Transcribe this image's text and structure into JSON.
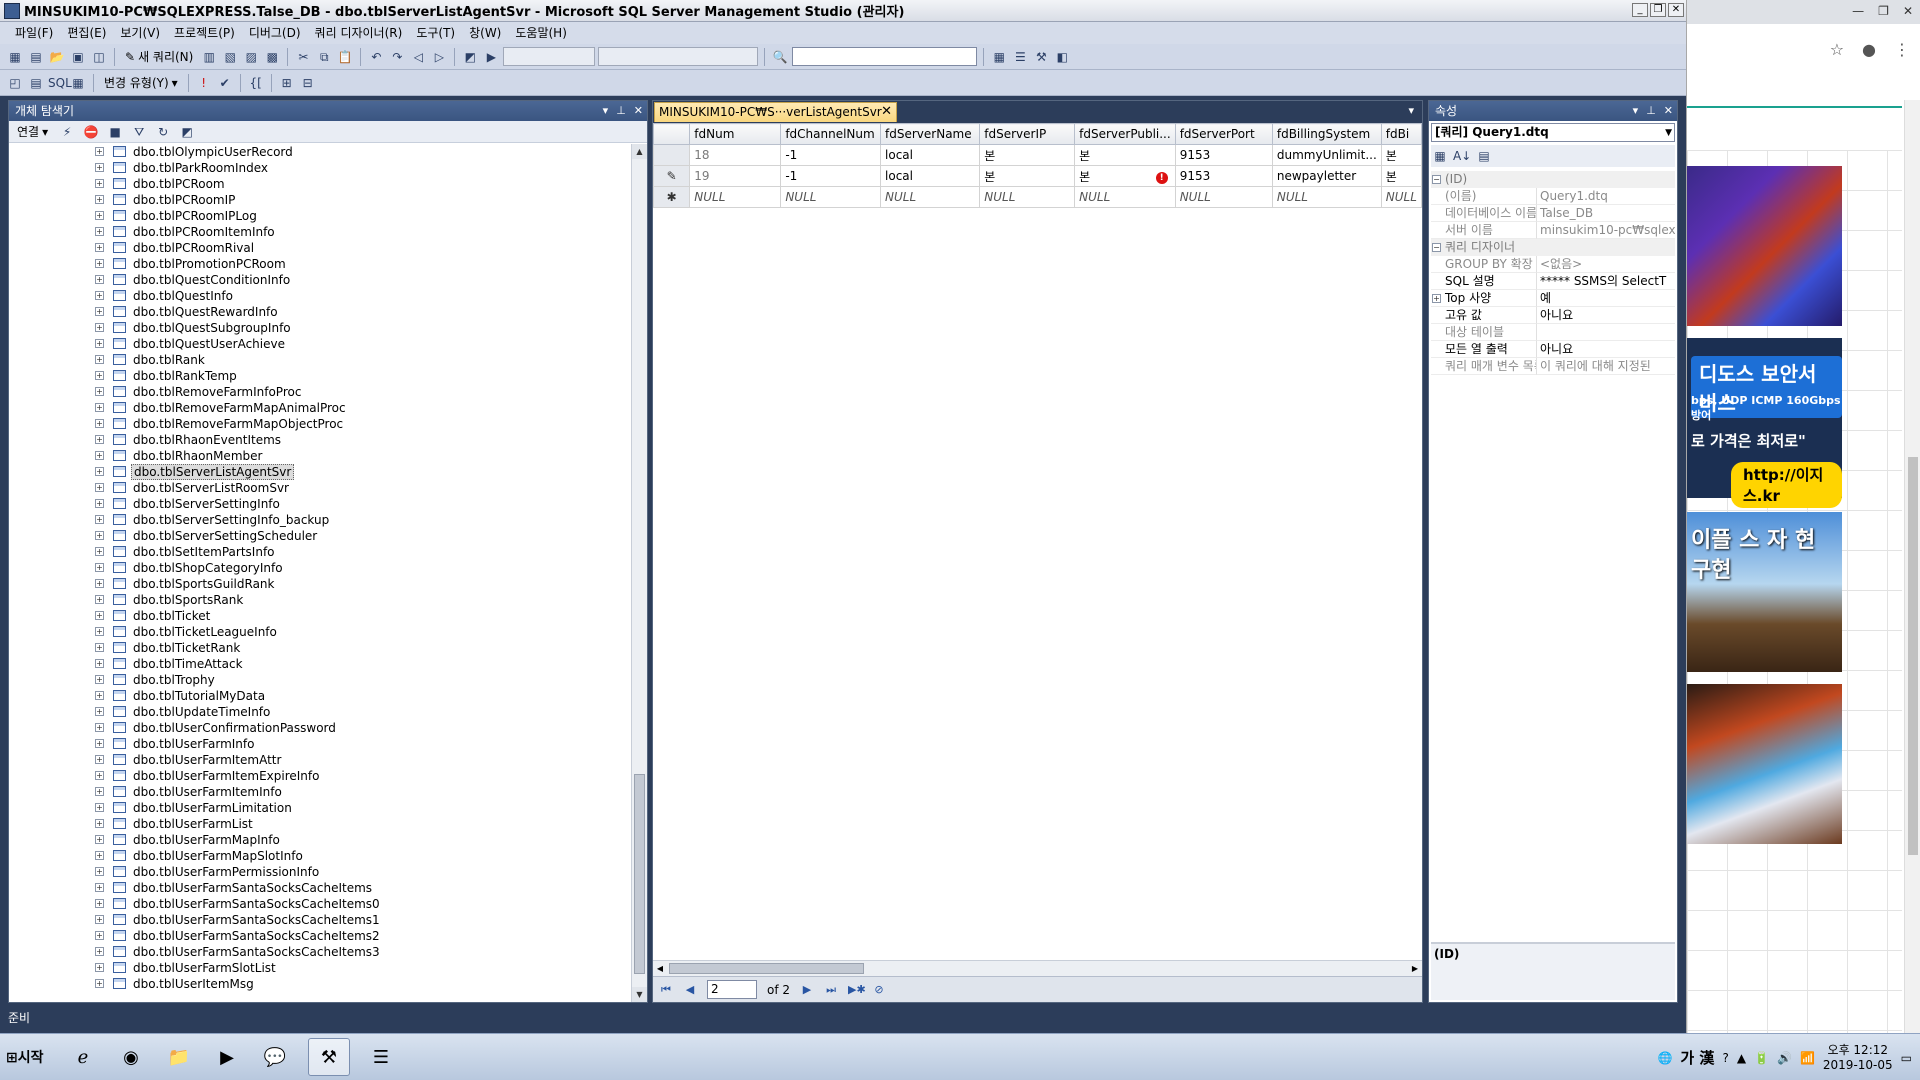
{
  "window": {
    "title": "MINSUKIM10-PC₩SQLEXPRESS.Talse_DB - dbo.tblServerListAgentSvr - Microsoft SQL Server Management Studio (관리자)"
  },
  "menu": [
    "파일(F)",
    "편집(E)",
    "보기(V)",
    "프로젝트(P)",
    "디버그(D)",
    "쿼리 디자이너(R)",
    "도구(T)",
    "창(W)",
    "도움말(H)"
  ],
  "toolbar": {
    "new_query": "새 쿼리(N)",
    "change_type": "변경 유형(Y)"
  },
  "object_explorer": {
    "title": "개체 탐색기",
    "connect": "연결",
    "items": [
      "dbo.tblOlympicUserRecord",
      "dbo.tblParkRoomIndex",
      "dbo.tblPCRoom",
      "dbo.tblPCRoomIP",
      "dbo.tblPCRoomIPLog",
      "dbo.tblPCRoomItemInfo",
      "dbo.tblPCRoomRival",
      "dbo.tblPromotionPCRoom",
      "dbo.tblQuestConditionInfo",
      "dbo.tblQuestInfo",
      "dbo.tblQuestRewardInfo",
      "dbo.tblQuestSubgroupInfo",
      "dbo.tblQuestUserAchieve",
      "dbo.tblRank",
      "dbo.tblRankTemp",
      "dbo.tblRemoveFarmInfoProc",
      "dbo.tblRemoveFarmMapAnimalProc",
      "dbo.tblRemoveFarmMapObjectProc",
      "dbo.tblRhaonEventItems",
      "dbo.tblRhaonMember",
      "dbo.tblServerListAgentSvr",
      "dbo.tblServerListRoomSvr",
      "dbo.tblServerSettingInfo",
      "dbo.tblServerSettingInfo_backup",
      "dbo.tblServerSettingScheduler",
      "dbo.tblSetItemPartsInfo",
      "dbo.tblShopCategoryInfo",
      "dbo.tblSportsGuildRank",
      "dbo.tblSportsRank",
      "dbo.tblTicket",
      "dbo.tblTicketLeagueInfo",
      "dbo.tblTicketRank",
      "dbo.tblTimeAttack",
      "dbo.tblTrophy",
      "dbo.tblTutorialMyData",
      "dbo.tblUpdateTimeInfo",
      "dbo.tblUserConfirmationPassword",
      "dbo.tblUserFarmInfo",
      "dbo.tblUserFarmItemAttr",
      "dbo.tblUserFarmItemExpireInfo",
      "dbo.tblUserFarmItemInfo",
      "dbo.tblUserFarmLimitation",
      "dbo.tblUserFarmList",
      "dbo.tblUserFarmMapInfo",
      "dbo.tblUserFarmMapSlotInfo",
      "dbo.tblUserFarmPermissionInfo",
      "dbo.tblUserFarmSantaSocksCacheItems",
      "dbo.tblUserFarmSantaSocksCacheItems0",
      "dbo.tblUserFarmSantaSocksCacheItems1",
      "dbo.tblUserFarmSantaSocksCacheItems2",
      "dbo.tblUserFarmSantaSocksCacheItems3",
      "dbo.tblUserFarmSlotList",
      "dbo.tblUserItemMsg"
    ],
    "selected_index": 20
  },
  "document": {
    "tab_label": "MINSUKIM10-PC₩S···verListAgentSvr",
    "columns": [
      "fdNum",
      "fdChannelNum",
      "fdServerName",
      "fdServerIP",
      "fdServerPubli...",
      "fdServerPort",
      "fdBillingSystem",
      "fdBi"
    ],
    "rows": [
      {
        "marker": "",
        "cells": [
          "18",
          "-1",
          "local",
          "본",
          "본",
          "9153",
          "dummyUnlimit...",
          "본"
        ],
        "error": false
      },
      {
        "marker": "✎",
        "cells": [
          "19",
          "-1",
          "local",
          "본",
          "본",
          "9153",
          "newpayletter",
          "본"
        ],
        "error": true
      },
      {
        "marker": "✱",
        "cells": [
          "NULL",
          "NULL",
          "NULL",
          "NULL",
          "NULL",
          "NULL",
          "NULL",
          "NULL"
        ],
        "error": false
      }
    ],
    "page_current": "2",
    "page_total": "of 2"
  },
  "properties": {
    "title": "속성",
    "selector": "[쿼리] Query1.dtq",
    "rows": [
      {
        "type": "cat",
        "key": "(ID)"
      },
      {
        "type": "gray",
        "key": "(이름)",
        "value": "Query1.dtq"
      },
      {
        "type": "gray",
        "key": "데이터베이스 이름",
        "value": "Talse_DB"
      },
      {
        "type": "gray",
        "key": "서버 이름",
        "value": "minsukim10-pc₩sqlex"
      },
      {
        "type": "cat",
        "key": "쿼리 디자이너"
      },
      {
        "type": "gray",
        "key": "GROUP BY 확장",
        "value": "<없음>"
      },
      {
        "type": "norm",
        "key": "SQL 설명",
        "value": "***** SSMS의 SelectT"
      },
      {
        "type": "exp",
        "key": "Top 사양",
        "value": "예"
      },
      {
        "type": "norm",
        "key": "고유 값",
        "value": "아니요"
      },
      {
        "type": "gray",
        "key": "대상 테이블",
        "value": ""
      },
      {
        "type": "norm",
        "key": "모든 열 출력",
        "value": "아니요"
      },
      {
        "type": "gray",
        "key": "쿼리 매개 변수 목록",
        "value": "이 쿼리에 대해 지정된"
      }
    ],
    "desc": "(ID)"
  },
  "status": {
    "text": "준비"
  },
  "browser": {
    "ad2_title": "디도스 보안서비스",
    "ad2_sub": "bps, UDP ICMP 160Gbps 방어",
    "ad2_line": "로 가격은 최저로\"",
    "ad2_url": "http://이지스.kr",
    "ad3_text": "이플 스 자 현 구현"
  },
  "taskbar": {
    "start": "시작",
    "ime": "가 漢",
    "time": "오후 12:12",
    "date": "2019-10-05"
  }
}
